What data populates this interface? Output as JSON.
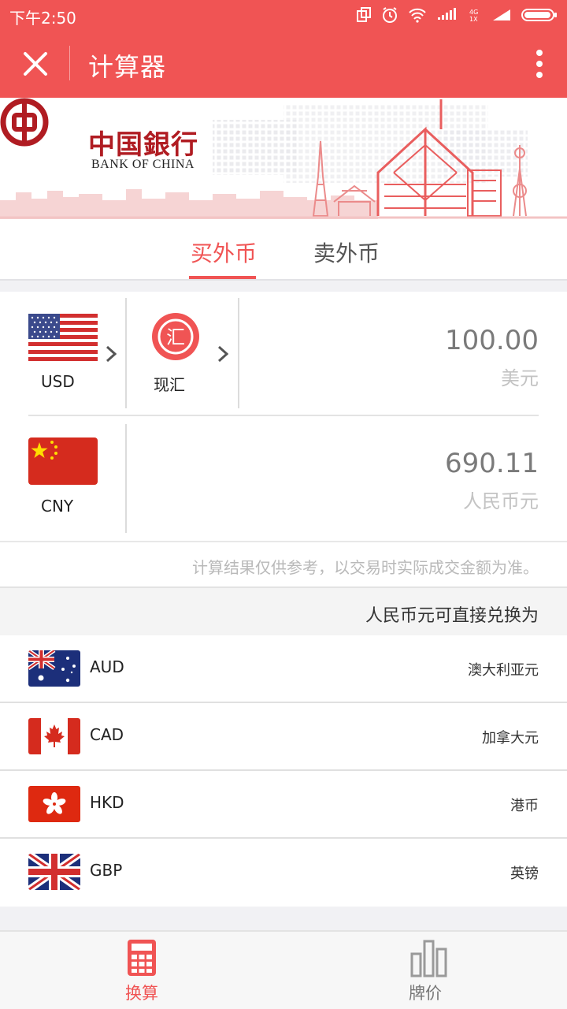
{
  "status_bar": {
    "time": "下午2:50",
    "network_label": "4G\n1X"
  },
  "app_bar": {
    "title": "计算器"
  },
  "banner": {
    "bank_name_cn": "中国銀行",
    "bank_name_en": "BANK OF CHINA"
  },
  "tabs": [
    {
      "label": "买外币",
      "active": true
    },
    {
      "label": "卖外币",
      "active": false
    }
  ],
  "converter": {
    "from": {
      "code": "USD",
      "mode_label": "现汇",
      "mode_glyph": "汇",
      "amount": "100.00",
      "unit": "美元"
    },
    "to": {
      "code": "CNY",
      "amount": "690.11",
      "unit": "人民币元"
    }
  },
  "disclaimer": "计算结果仅供参考，以交易时实际成交金额为准。",
  "section_title": "人民币元可直接兑换为",
  "currencies": [
    {
      "code": "AUD",
      "name": "澳大利亚元",
      "flag": "au-flag"
    },
    {
      "code": "CAD",
      "name": "加拿大元",
      "flag": "ca-flag"
    },
    {
      "code": "HKD",
      "name": "港币",
      "flag": "hk-flag"
    },
    {
      "code": "GBP",
      "name": "英镑",
      "flag": "gb-flag"
    }
  ],
  "bottom_nav": [
    {
      "label": "换算",
      "icon": "calculator-icon",
      "active": true
    },
    {
      "label": "牌价",
      "icon": "bar-chart-icon",
      "active": false
    }
  ],
  "colors": {
    "accent": "#f05454",
    "bank_red": "#b01c22"
  }
}
